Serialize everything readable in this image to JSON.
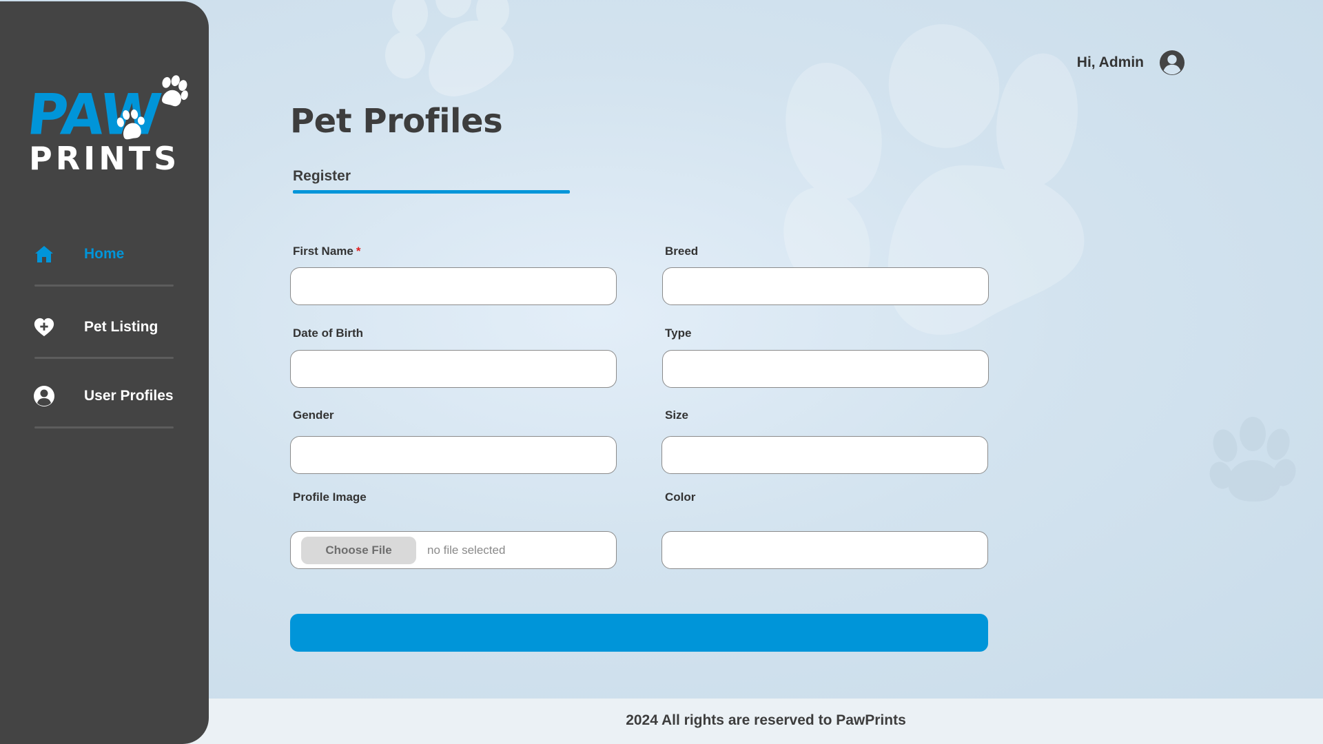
{
  "brand": {
    "logo_top": "PAW",
    "logo_bottom": "PRINTS"
  },
  "sidebar": {
    "items": [
      {
        "label": "Home",
        "icon": "home-icon",
        "active": true
      },
      {
        "label": "Pet Listing",
        "icon": "heart-plus-icon",
        "active": false
      },
      {
        "label": "User Profiles",
        "icon": "user-circle-icon",
        "active": false
      }
    ]
  },
  "header": {
    "greeting": "Hi, Admin",
    "avatar_icon": "user-circle-icon"
  },
  "page": {
    "title": "Pet Profiles",
    "tab_label": "Register"
  },
  "form": {
    "first_name": {
      "label": "First Name",
      "required_mark": "*",
      "value": ""
    },
    "breed": {
      "label": "Breed",
      "value": ""
    },
    "date_of_birth": {
      "label": "Date of Birth",
      "value": ""
    },
    "type": {
      "label": "Type",
      "value": ""
    },
    "gender": {
      "label": "Gender",
      "value": ""
    },
    "size": {
      "label": "Size",
      "value": ""
    },
    "profile_image": {
      "label": "Profile Image",
      "button_label": "Choose File",
      "status": "no file selected"
    },
    "color": {
      "label": "Color",
      "value": ""
    },
    "submit_label": ""
  },
  "footer": {
    "text": "2024 All rights are reserved to PawPrints"
  },
  "colors": {
    "accent": "#0095d9",
    "sidebar_bg": "#444444",
    "required": "#e02020"
  }
}
